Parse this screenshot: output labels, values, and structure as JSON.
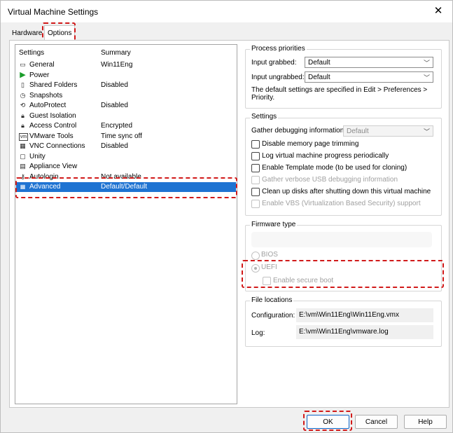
{
  "window": {
    "title": "Virtual Machine Settings"
  },
  "tabs": [
    {
      "label": "Hardware"
    },
    {
      "label": "Options"
    }
  ],
  "list": {
    "col_settings": "Settings",
    "col_summary": "Summary",
    "items": [
      {
        "name": "General",
        "summary": "Win11Eng",
        "icon": "general-icon"
      },
      {
        "name": "Power",
        "summary": "",
        "icon": "power-icon"
      },
      {
        "name": "Shared Folders",
        "summary": "Disabled",
        "icon": "shared-folders-icon"
      },
      {
        "name": "Snapshots",
        "summary": "",
        "icon": "snapshots-icon"
      },
      {
        "name": "AutoProtect",
        "summary": "Disabled",
        "icon": "autoprotect-icon"
      },
      {
        "name": "Guest Isolation",
        "summary": "",
        "icon": "lock-icon"
      },
      {
        "name": "Access Control",
        "summary": "Encrypted",
        "icon": "lock-icon"
      },
      {
        "name": "VMware Tools",
        "summary": "Time sync off",
        "icon": "vmware-tools-icon"
      },
      {
        "name": "VNC Connections",
        "summary": "Disabled",
        "icon": "vnc-icon"
      },
      {
        "name": "Unity",
        "summary": "",
        "icon": "unity-icon"
      },
      {
        "name": "Appliance View",
        "summary": "",
        "icon": "appliance-view-icon"
      },
      {
        "name": "Autologin",
        "summary": "Not available",
        "icon": "autologin-icon"
      },
      {
        "name": "Advanced",
        "summary": "Default/Default",
        "icon": "advanced-icon"
      }
    ],
    "selected_index": 12
  },
  "process_priorities": {
    "title": "Process priorities",
    "grabbed_label": "Input grabbed:",
    "grabbed_value": "Default",
    "ungrabbed_label": "Input ungrabbed:",
    "ungrabbed_value": "Default",
    "note": "The default settings are specified in Edit > Preferences > Priority."
  },
  "settings": {
    "title": "Settings",
    "gather_label": "Gather debugging information:",
    "gather_value": "Default",
    "checkboxes": [
      {
        "label": "Disable memory page trimming",
        "enabled": true,
        "checked": false
      },
      {
        "label": "Log virtual machine progress periodically",
        "enabled": true,
        "checked": false
      },
      {
        "label": "Enable Template mode (to be used for cloning)",
        "enabled": true,
        "checked": false
      },
      {
        "label": "Gather verbose USB debugging information",
        "enabled": false,
        "checked": false
      },
      {
        "label": "Clean up disks after shutting down this virtual machine",
        "enabled": true,
        "checked": false
      },
      {
        "label": "Enable VBS (Virtualization Based Security) support",
        "enabled": false,
        "checked": false
      }
    ]
  },
  "firmware": {
    "title": "Firmware type",
    "bios_label": "BIOS",
    "uefi_label": "UEFI",
    "selected": "UEFI",
    "secure_boot_label": "Enable secure boot"
  },
  "file_locations": {
    "title": "File locations",
    "config_label": "Configuration:",
    "config_value": "E:\\vm\\Win11Eng\\Win11Eng.vmx",
    "log_label": "Log:",
    "log_value": "E:\\vm\\Win11Eng\\vmware.log"
  },
  "buttons": {
    "ok": "OK",
    "cancel": "Cancel",
    "help": "Help"
  },
  "annotation_color": "#d11a1a",
  "selection_color": "#1e73d2"
}
